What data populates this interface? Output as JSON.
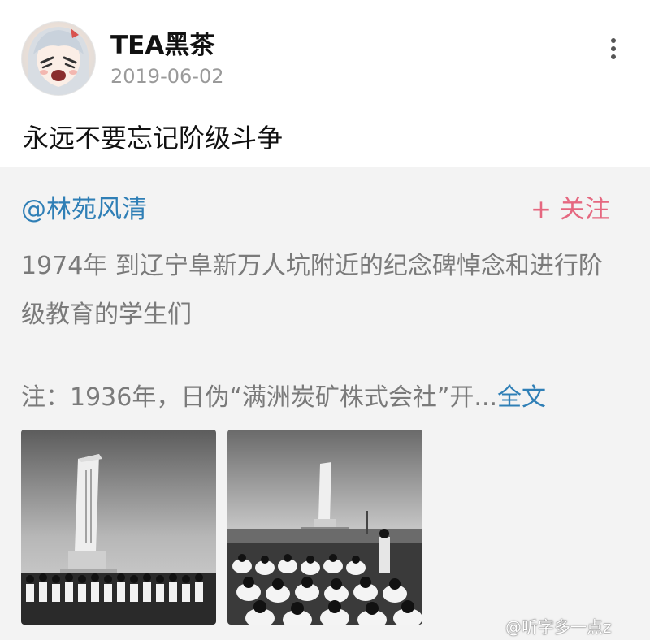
{
  "post": {
    "username": "TEA黑茶",
    "date": "2019-06-02",
    "text": "永远不要忘记阶级斗争",
    "more_icon": "more-vertical-icon"
  },
  "repost": {
    "original_user": "@林苑风清",
    "follow_label": "+ 关注",
    "text": "1974年  到辽宁阜新万人坑附近的纪念碑悼念和进行阶级教育的学生们",
    "note": "注：1936年，日伪“满洲炭矿株式会社”开...",
    "full_text_link": "全文"
  },
  "watermark": "@听字多一点z",
  "colors": {
    "link": "#2f7fb6",
    "follow": "#e5677f",
    "secondary_text": "#7a7a7a",
    "repost_bg": "#f3f3f3"
  }
}
